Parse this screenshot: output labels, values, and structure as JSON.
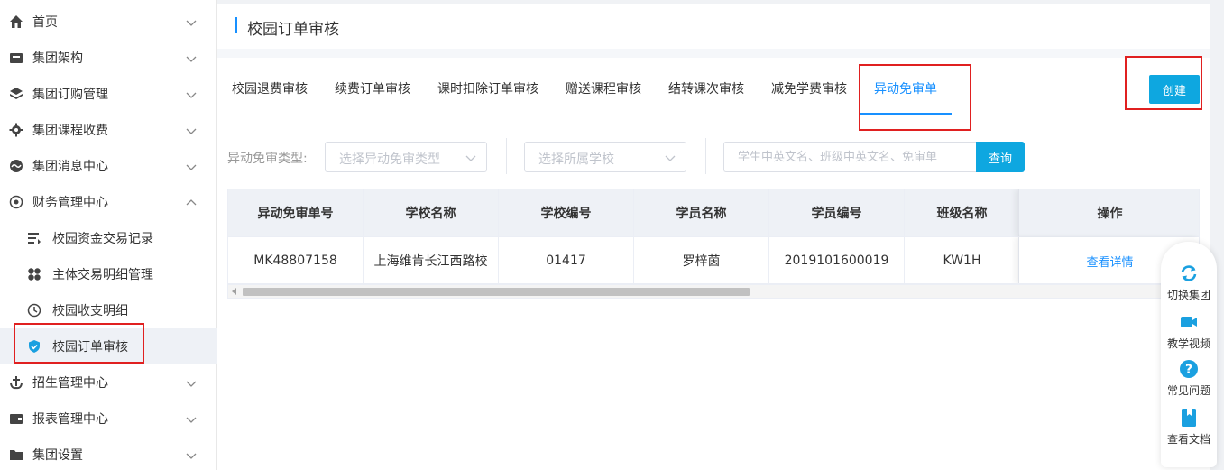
{
  "sidebar": {
    "items": [
      {
        "label": "首页"
      },
      {
        "label": "集团架构"
      },
      {
        "label": "集团订购管理"
      },
      {
        "label": "集团课程收费"
      },
      {
        "label": "集团消息中心"
      },
      {
        "label": "财务管理中心"
      },
      {
        "label": "校园资金交易记录"
      },
      {
        "label": "主体交易明细管理"
      },
      {
        "label": "校园收支明细"
      },
      {
        "label": "校园订单审核"
      },
      {
        "label": "招生管理中心"
      },
      {
        "label": "报表管理中心"
      },
      {
        "label": "集团设置"
      }
    ]
  },
  "header": {
    "title": "校园订单审核"
  },
  "tabs": [
    {
      "label": "校园退费审核"
    },
    {
      "label": "续费订单审核"
    },
    {
      "label": "课时扣除订单审核"
    },
    {
      "label": "赠送课程审核"
    },
    {
      "label": "结转课次审核"
    },
    {
      "label": "减免学费审核"
    },
    {
      "label": "异动免审单"
    }
  ],
  "actions": {
    "create_label": "创建"
  },
  "filters": {
    "type_label": "异动免审类型:",
    "type_placeholder": "选择异动免审类型",
    "school_placeholder": "选择所属学校",
    "search_placeholder": "学生中英文名、班级中英文名、免审单",
    "query_label": "查询"
  },
  "table": {
    "columns": [
      "异动免审单号",
      "学校名称",
      "学校编号",
      "学员名称",
      "学员编号",
      "班级名称",
      "操作"
    ],
    "rows": [
      {
        "order_no": "MK48807158",
        "school_name": "上海维肯长江西路校",
        "school_code": "01417",
        "student_name": "罗梓茵",
        "student_no": "2019101600019",
        "class_name": "KW1H",
        "action": "查看详情"
      }
    ]
  },
  "float_panel": {
    "items": [
      {
        "label": "切换集团",
        "icon": "switch-icon"
      },
      {
        "label": "教学视频",
        "icon": "video-icon"
      },
      {
        "label": "常见问题",
        "icon": "question-icon"
      },
      {
        "label": "查看文档",
        "icon": "document-icon"
      }
    ]
  },
  "colors": {
    "accent": "#1890ff",
    "button": "#0ea7e0",
    "highlight_box": "#e02020"
  }
}
